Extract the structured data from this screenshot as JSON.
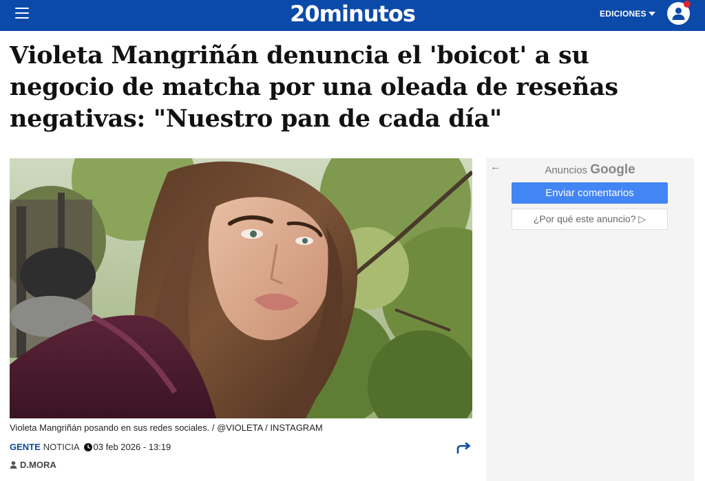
{
  "header": {
    "logo": "20minutos",
    "editions_label": "EDICIONES",
    "icons": {
      "menu": "menu-icon",
      "user": "user-icon",
      "caret": "caret-down-icon"
    },
    "colors": {
      "bar": "#0b4aa8",
      "notification": "#e4202a"
    }
  },
  "article": {
    "headline": "Violeta Mangriñán denuncia el 'boicot' a su negocio de matcha por una oleada de reseñas negativas: \"Nuestro pan de cada día\"",
    "photo_caption": "Violeta Mangriñán posando en sus redes sociales. / @VIOLETA / INSTAGRAM",
    "section": "GENTE",
    "kind": "NOTICIA",
    "date": "03 feb 2026 - 13:19",
    "author": "D.MORA",
    "icons": {
      "clock": "clock-icon",
      "share": "share-icon",
      "author": "person-icon"
    }
  },
  "ad": {
    "title_prefix": "Anuncios",
    "title_brand": "Google",
    "feedback_button": "Enviar comentarios",
    "why_button": "¿Por qué este anuncio? ▷",
    "icons": {
      "back": "back-arrow-icon"
    }
  }
}
